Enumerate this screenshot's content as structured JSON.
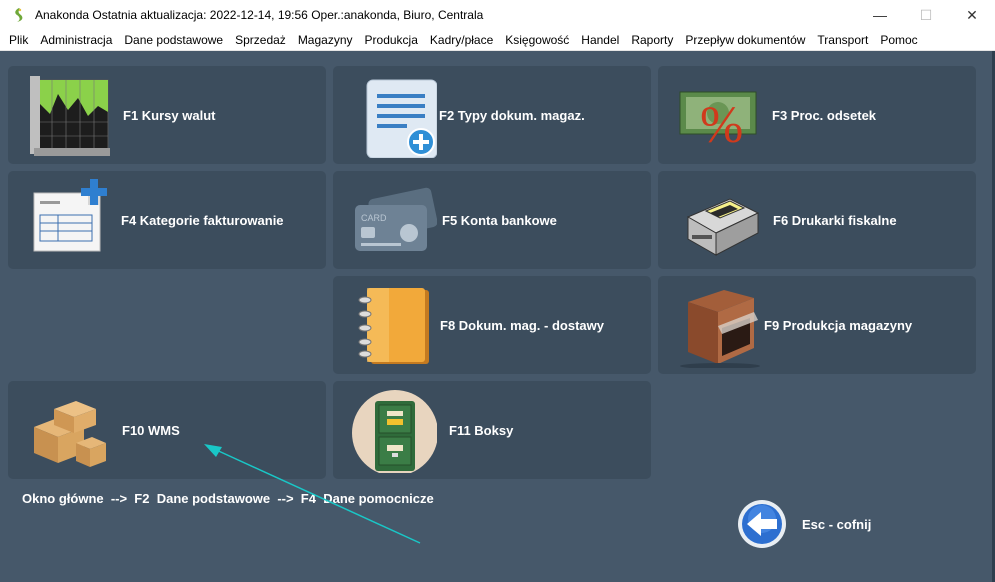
{
  "window": {
    "title": "Anakonda Ostatnia aktualizacja: 2022-12-14, 19:56 Oper.:anakonda, Biuro, Centrala",
    "minimize_glyph": "—",
    "maximize_glyph": "☐",
    "close_glyph": "✕"
  },
  "menu": [
    "Plik",
    "Administracja",
    "Dane podstawowe",
    "Sprzedaż",
    "Magazyny",
    "Produkcja",
    "Kadry/płace",
    "Księgowość",
    "Handel",
    "Raporty",
    "Przepływ dokumentów",
    "Transport",
    "Pomoc"
  ],
  "tiles": {
    "f1": "F1  Kursy walut",
    "f2": "F2  Typy dokum. magaz.",
    "f3": "F3  Proc. odsetek",
    "f4": "F4  Kategorie fakturowanie",
    "f5": "F5  Konta bankowe",
    "f6": "F6  Drukarki fiskalne",
    "f8": "F8  Dokum. mag. - dostawy",
    "f9": "F9  Produkcja magazyny",
    "f10": "F10  WMS",
    "f11": "F11  Boksy"
  },
  "icons": {
    "f1": "chart-icon",
    "f2": "document-add-icon",
    "f3": "percent-money-icon",
    "f4": "invoice-icon",
    "f5": "bank-card-icon",
    "f6": "printer-icon",
    "f8": "notebook-icon",
    "f9": "warehouse-icon",
    "f10": "boxes-icon",
    "f11": "cabinet-icon"
  },
  "breadcrumb": "Okno główne  -->  F2  Dane podstawowe  -->  F4  Dane pomocnicze",
  "esc_label": "Esc - cofnij",
  "colors": {
    "background": "#46586a",
    "tile": "#3c4d5d",
    "annotation_arrow": "#19c7c7"
  }
}
